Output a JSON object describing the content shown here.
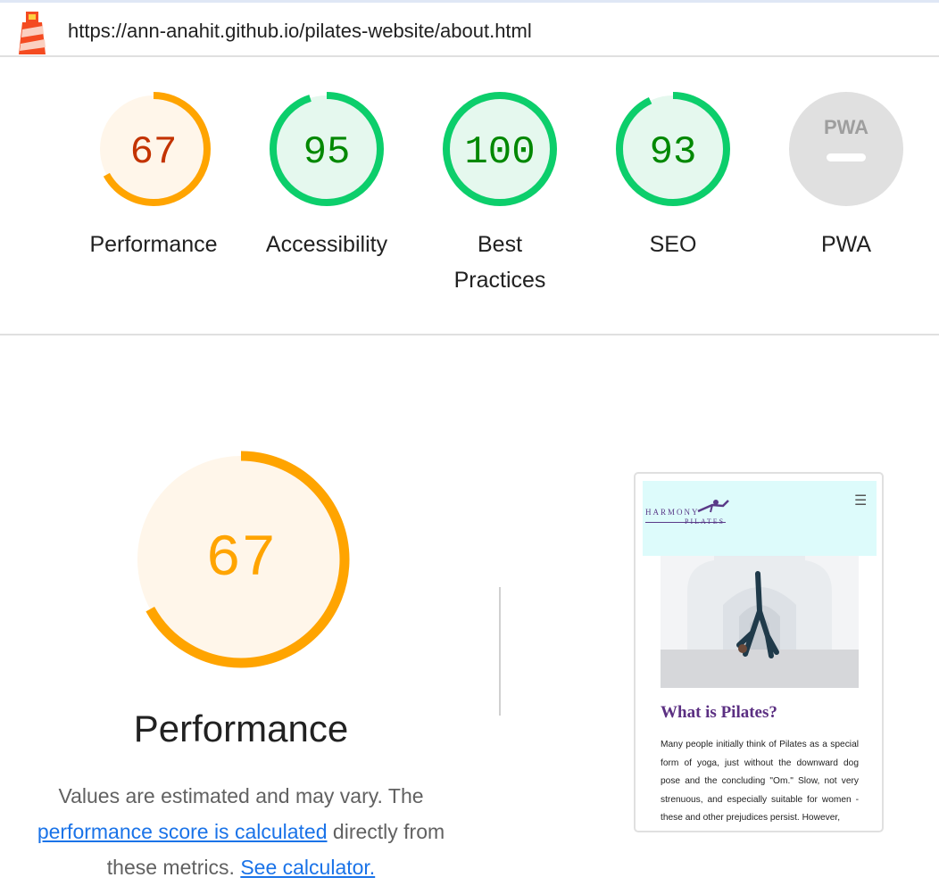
{
  "url": "https://ann-anahit.github.io/pilates-website/about.html",
  "gauges": [
    {
      "label": "Performance",
      "score": "67",
      "fraction": 0.67,
      "color": "#ffa400",
      "textColor": "#c33300",
      "fill": "#fff6ea"
    },
    {
      "label": "Accessibility",
      "score": "95",
      "fraction": 0.95,
      "color": "#0cce6b",
      "textColor": "#008800",
      "fill": "#e5f8ee"
    },
    {
      "label_line1": "Best",
      "label_line2": "Practices",
      "score": "100",
      "fraction": 1.0,
      "color": "#0cce6b",
      "textColor": "#008800",
      "fill": "#e5f8ee"
    },
    {
      "label": "SEO",
      "score": "93",
      "fraction": 0.93,
      "color": "#0cce6b",
      "textColor": "#008800",
      "fill": "#e5f8ee"
    },
    {
      "label": "PWA",
      "badge": "PWA",
      "color": "#e0e0e0"
    }
  ],
  "main": {
    "score": "67",
    "fraction": 0.67,
    "title": "Performance",
    "desc_text1": "Values are estimated and may vary. The",
    "desc_link1": "performance score is calculated",
    "desc_text2": "directly from these metrics.",
    "desc_link2": "See calculator."
  },
  "screenshot": {
    "brand_line1": "HARMONY",
    "brand_line2": "PILATES",
    "heading": "What is Pilates?",
    "paragraph": "Many people initially think of Pilates as a special form of yoga, just without the downward dog pose and the concluding \"Om.\" Slow, not very strenuous, and especially suitable for women - these and other prejudices persist. However,"
  }
}
